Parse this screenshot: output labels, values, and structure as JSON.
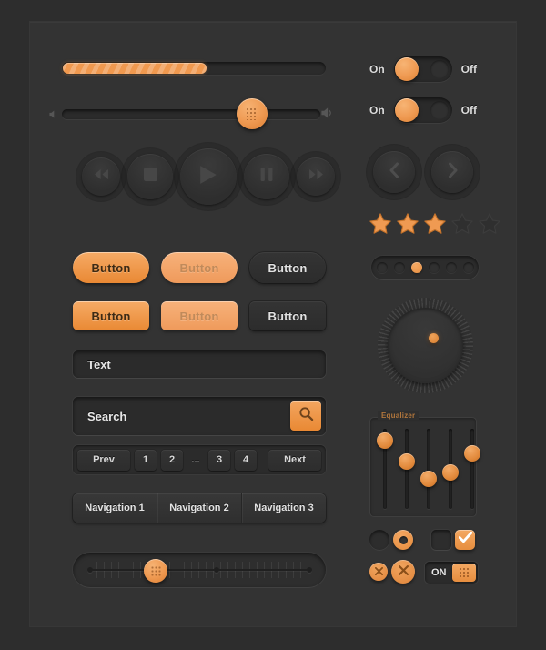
{
  "theme": {
    "background": "#2d2d2d",
    "panel": "#333333",
    "accent": "#ef9a52",
    "accent_dark": "#e0853a",
    "text": "#e3e3e3",
    "muted_text": "#8c8c8c"
  },
  "progress": {
    "name": "progress-bar",
    "value_percent": 55
  },
  "volume_slider": {
    "name": "volume-slider",
    "value_percent": 76,
    "left_icon": "speaker-low-icon",
    "right_icon": "speaker-high-icon"
  },
  "media_player": {
    "buttons": [
      {
        "name": "rewind-button",
        "icon": "rewind-icon",
        "size": 42
      },
      {
        "name": "stop-button",
        "icon": "stop-icon",
        "size": 50
      },
      {
        "name": "play-button",
        "icon": "play-icon",
        "size": 62
      },
      {
        "name": "pause-button",
        "icon": "pause-icon",
        "size": 50
      },
      {
        "name": "next-button",
        "icon": "fast-forward-icon",
        "size": 42
      }
    ]
  },
  "buttons": {
    "row1": [
      {
        "label": "Button",
        "style": "orange",
        "shape": "pill"
      },
      {
        "label": "Button",
        "style": "orange-disabled",
        "shape": "pill"
      },
      {
        "label": "Button",
        "style": "dark",
        "shape": "pill"
      }
    ],
    "row2": [
      {
        "label": "Button",
        "style": "orange",
        "shape": "rect"
      },
      {
        "label": "Button",
        "style": "orange-disabled",
        "shape": "rect"
      },
      {
        "label": "Button",
        "style": "dark",
        "shape": "rect"
      }
    ]
  },
  "text_input": {
    "name": "text-input",
    "value": "Text",
    "placeholder": "Text"
  },
  "search_input": {
    "name": "search-input",
    "value": "Search",
    "placeholder": "Search",
    "button_icon": "search-icon"
  },
  "pagination": {
    "prev_label": "Prev",
    "next_label": "Next",
    "pages": [
      "1",
      "2",
      "...",
      "3",
      "4"
    ]
  },
  "navbar": {
    "items": [
      "Navigation 1",
      "Navigation 2",
      "Navigation 3"
    ]
  },
  "ruler_slider": {
    "name": "ruler-slider",
    "value_percent": 37,
    "stop_count": 3
  },
  "toggles": [
    {
      "on_label": "On",
      "off_label": "Off",
      "state": "on"
    },
    {
      "on_label": "On",
      "off_label": "Off",
      "state": "on"
    }
  ],
  "arrow_buttons": [
    {
      "name": "previous-arrow-button",
      "icon": "chevron-left-icon"
    },
    {
      "name": "next-arrow-button",
      "icon": "chevron-right-icon"
    }
  ],
  "rating": {
    "name": "star-rating",
    "value": 3,
    "max": 5
  },
  "dots_pager": {
    "count": 6,
    "active_index": 2
  },
  "rotary_knob": {
    "name": "rotary-knob",
    "indicator_angle_deg": 55,
    "tick_count": 72
  },
  "equalizer": {
    "legend": "Equalizer",
    "bands": [
      {
        "name": "band-1",
        "value_percent": 88
      },
      {
        "name": "band-2",
        "value_percent": 62
      },
      {
        "name": "band-3",
        "value_percent": 40
      },
      {
        "name": "band-4",
        "value_percent": 48
      },
      {
        "name": "band-5",
        "value_percent": 70
      }
    ]
  },
  "choices": {
    "radio_off": {
      "name": "radio-unchecked",
      "checked": false
    },
    "radio_on": {
      "name": "radio-checked",
      "checked": true
    },
    "check_off": {
      "name": "checkbox-unchecked",
      "checked": false
    },
    "check_on": {
      "name": "checkbox-checked",
      "checked": true,
      "icon": "check-icon"
    },
    "close_small": {
      "name": "close-button-small",
      "icon": "close-icon"
    },
    "close_large": {
      "name": "close-button-large",
      "icon": "close-icon"
    },
    "on_switch": {
      "name": "on-switch",
      "label": "ON",
      "handle_icon": "grip-icon"
    }
  }
}
